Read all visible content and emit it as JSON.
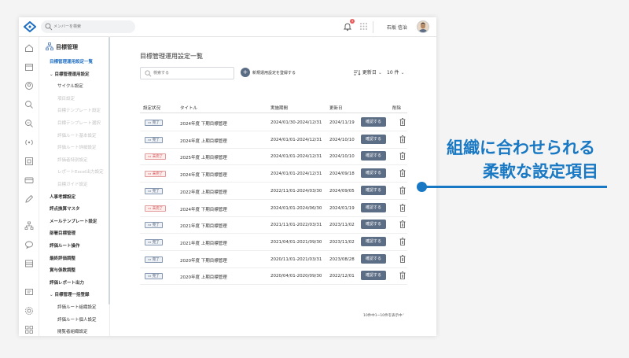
{
  "topbar": {
    "search_placeholder": "メンバーを検索",
    "notification_count": "3",
    "username": "石坂 信治"
  },
  "sidebar": {
    "header": "目標管理",
    "items": [
      {
        "label": "目標管理運用設定一覧",
        "state": "active"
      },
      {
        "label": "目標管理運用設定",
        "state": "section"
      },
      {
        "label": "サイクル設定",
        "state": "normal"
      },
      {
        "label": "項目設定",
        "state": "disabled"
      },
      {
        "label": "目標テンプレート設定",
        "state": "disabled"
      },
      {
        "label": "目標テンプレート選択",
        "state": "disabled"
      },
      {
        "label": "評価ルート基本設定",
        "state": "disabled"
      },
      {
        "label": "評価ルート詳細設定",
        "state": "disabled"
      },
      {
        "label": "評価者特別設定",
        "state": "disabled"
      },
      {
        "label": "レポートExcel出力設定",
        "state": "disabled"
      },
      {
        "label": "目標ガイド設定",
        "state": "disabled"
      },
      {
        "label": "人事考課設定",
        "state": "bold"
      },
      {
        "label": "評点換算マスタ",
        "state": "bold"
      },
      {
        "label": "メールテンプレート設定",
        "state": "bold"
      },
      {
        "label": "部署目標管理",
        "state": "bold"
      },
      {
        "label": "評価ルート操作",
        "state": "bold"
      },
      {
        "label": "最終評価調整",
        "state": "bold"
      },
      {
        "label": "賞与係数調整",
        "state": "bold"
      },
      {
        "label": "評価レポート出力",
        "state": "bold"
      },
      {
        "label": "目標管理一括登録",
        "state": "section"
      },
      {
        "label": "評価ルート組織設定",
        "state": "normal"
      },
      {
        "label": "評価ルート個人設定",
        "state": "normal"
      },
      {
        "label": "閲覧者組織設定",
        "state": "normal"
      }
    ]
  },
  "main": {
    "title": "目標管理運用設定一覧",
    "filter_placeholder": "検索する",
    "add_label": "新規運用設定を登録する",
    "sort_label": "更新日",
    "per_page_label": "10 件",
    "columns": [
      "設定状況",
      "タイトル",
      "実施期間",
      "更新日",
      "削除"
    ],
    "confirm_label": "確認する",
    "rows": [
      {
        "status": "完了",
        "pending": false,
        "title": "2024年度 下期目標管理",
        "period": "2024/01/30-2024/12/31",
        "updated": "2024/11/19"
      },
      {
        "status": "完了",
        "pending": false,
        "title": "2024年度 上期目標管理",
        "period": "2024/01/01-2024/12/31",
        "updated": "2024/10/10"
      },
      {
        "status": "未完了",
        "pending": true,
        "title": "2025年度 上期目標管理",
        "period": "2024/01/01-2024/12/31",
        "updated": "2024/10/10"
      },
      {
        "status": "未完了",
        "pending": true,
        "title": "2024年度 下期目標管理",
        "period": "2024/01/01-2024/12/31",
        "updated": "2024/09/18"
      },
      {
        "status": "完了",
        "pending": false,
        "title": "2022年度 上期目標管理",
        "period": "2022/11/01-2024/03/30",
        "updated": "2024/09/05"
      },
      {
        "status": "未完了",
        "pending": true,
        "title": "2024年度 下期目標管理",
        "period": "2024/01/01-2024/06/30",
        "updated": "2024/01/19"
      },
      {
        "status": "完了",
        "pending": false,
        "title": "2021年度 下期目標管理",
        "period": "2021/11/01-2022/03/31",
        "updated": "2023/11/02"
      },
      {
        "status": "完了",
        "pending": false,
        "title": "2021年度 上期目標管理",
        "period": "2021/04/01-2021/09/30",
        "updated": "2023/11/02"
      },
      {
        "status": "完了",
        "pending": false,
        "title": "2020年度 下期目標管理",
        "period": "2020/11/01-2021/03/31",
        "updated": "2023/08/28"
      },
      {
        "status": "完了",
        "pending": false,
        "title": "2020年度 上期目標管理",
        "period": "2020/04/01-2020/09/30",
        "updated": "2022/12/01"
      }
    ],
    "pagination_text": "10件中1~10件を表示中"
  },
  "callout": {
    "line1": "組織に合わせられる",
    "line2": "柔軟な設定項目",
    "color": "#1878c3"
  },
  "colors": {
    "accent": "#1878c3",
    "button": "#5c6d86",
    "active_nav": "#1f6fc4",
    "pending": "#d24a4a"
  }
}
